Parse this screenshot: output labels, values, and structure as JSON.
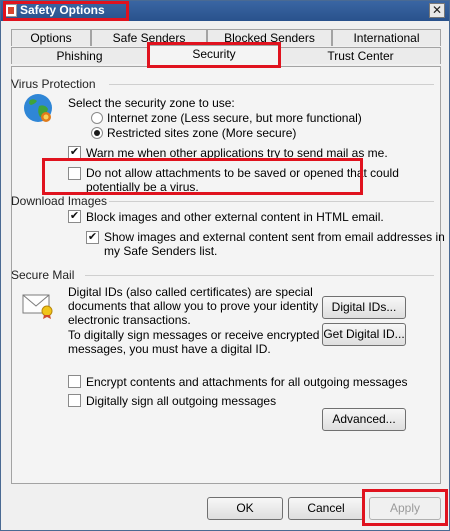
{
  "window": {
    "title": "Safety Options",
    "close_label": "✕"
  },
  "tabs_row1": [
    "Options",
    "Safe Senders",
    "Blocked Senders",
    "International"
  ],
  "tabs_row2": [
    "Phishing",
    "Security",
    "Trust Center"
  ],
  "virus_protection": {
    "heading": "Virus Protection",
    "zone_prompt": "Select the security zone to use:",
    "zone_internet": "Internet zone (Less secure, but more functional)",
    "zone_restricted": "Restricted sites zone (More secure)",
    "warn": "Warn me when other applications try to send mail as me.",
    "attachments_line1": "Do not allow attachments to be saved or opened that could",
    "attachments_line2": "potentially be a virus."
  },
  "download_images": {
    "heading": "Download Images",
    "block": "Block images and other external content in HTML email.",
    "show_line1": "Show images and external content sent from email addresses in",
    "show_line2": "my Safe Senders list."
  },
  "secure_mail": {
    "heading": "Secure Mail",
    "desc_line1": "Digital IDs (also called certificates) are special",
    "desc_line2": "documents that allow you to prove your identity in",
    "desc_line3": "electronic transactions.",
    "sign_line1": "To digitally sign messages or receive encrypted",
    "sign_line2": "messages, you must have a digital ID.",
    "digital_ids_button": "Digital IDs...",
    "get_digital_id_button": "Get Digital ID...",
    "encrypt": "Encrypt contents and attachments for all outgoing messages",
    "sign": "Digitally sign all outgoing messages",
    "advanced_button": "Advanced..."
  },
  "footer": {
    "ok": "OK",
    "cancel": "Cancel",
    "apply": "Apply"
  },
  "check_mark": "✔",
  "colors": {
    "highlight": "#e0121e",
    "titlebar": "#2f5a94"
  }
}
